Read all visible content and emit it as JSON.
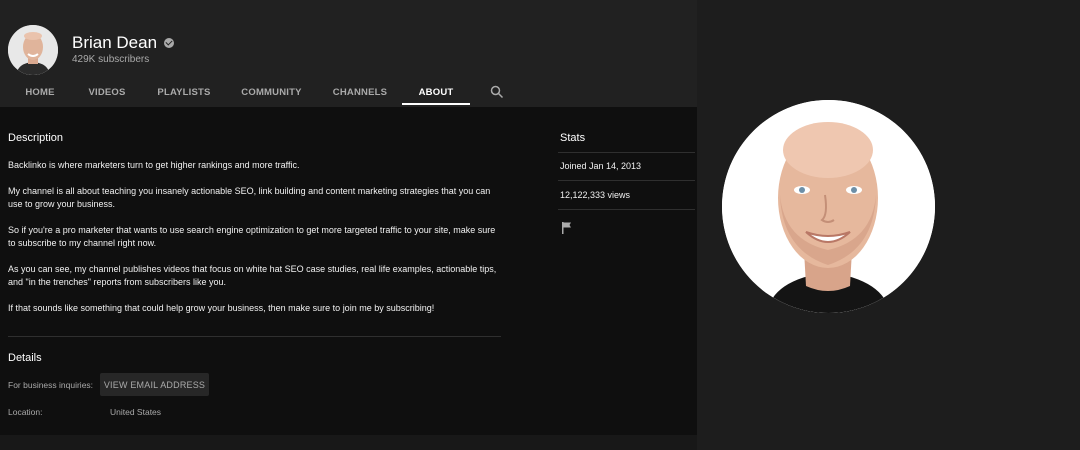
{
  "channel": {
    "name": "Brian Dean",
    "subscribers": "429K subscribers"
  },
  "tabs": [
    {
      "label": "HOME"
    },
    {
      "label": "VIDEOS"
    },
    {
      "label": "PLAYLISTS"
    },
    {
      "label": "COMMUNITY"
    },
    {
      "label": "CHANNELS"
    },
    {
      "label": "ABOUT"
    }
  ],
  "icons": {
    "search": "search-icon",
    "verified": "verified-check-icon",
    "flag": "flag-icon"
  },
  "about": {
    "description_heading": "Description",
    "description_paragraphs": [
      "Backlinko is where marketers turn to get higher rankings and more traffic.",
      "My channel is all about teaching you insanely actionable SEO, link building and content marketing strategies that you can use to grow your business.",
      "So if you're a pro marketer that wants to use search engine optimization to get more targeted traffic to your site, make sure to subscribe to my channel right now.",
      "As you can see, my channel publishes videos that focus on white hat SEO case studies, real life examples, actionable tips, and \"in the trenches\" reports from subscribers like you.",
      "If that sounds like something that could help grow your business, then make sure to join me by subscribing!"
    ],
    "details_heading": "Details",
    "business_label": "For business inquiries:",
    "email_button": "VIEW EMAIL ADDRESS",
    "location_label": "Location:",
    "location_value": "United States"
  },
  "stats": {
    "heading": "Stats",
    "joined": "Joined Jan 14, 2013",
    "views": "12,122,333 views"
  },
  "colors": {
    "background": "#1d1d1d",
    "header": "#212121",
    "content": "#0f0f0f"
  }
}
